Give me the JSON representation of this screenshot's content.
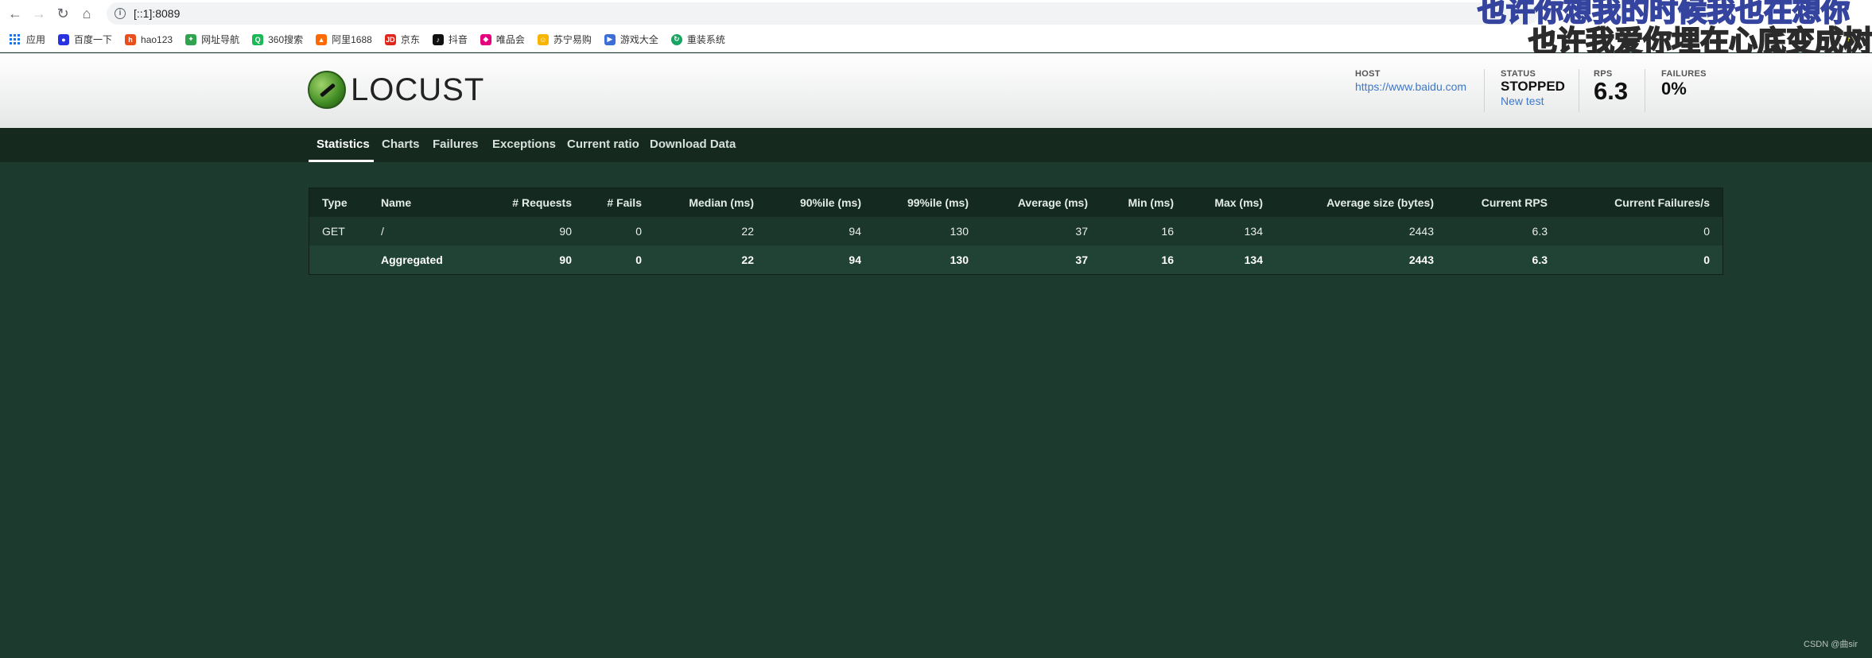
{
  "browser": {
    "url": "[::1]:8089",
    "icons": {
      "back": "back-arrow-icon",
      "forward": "forward-arrow-icon",
      "reload": "reload-icon",
      "home": "home-icon",
      "info": "info-icon"
    }
  },
  "bookmarks": [
    {
      "label": "应用",
      "icon": "apps-grid-icon",
      "color": "#1a73e8"
    },
    {
      "label": "百度一下",
      "icon": "baidu-paw-icon",
      "color": "#2932e1"
    },
    {
      "label": "hao123",
      "icon": "hao123-icon",
      "color": "#e94e1b"
    },
    {
      "label": "网址导航",
      "icon": "navigation-icon",
      "color": "#2ea44f"
    },
    {
      "label": "360搜索",
      "icon": "search-360-icon",
      "color": "#19b955"
    },
    {
      "label": "阿里1688",
      "icon": "ali1688-icon",
      "color": "#ff6a00"
    },
    {
      "label": "京东",
      "icon": "jd-icon",
      "color": "#e1251b"
    },
    {
      "label": "抖音",
      "icon": "douyin-icon",
      "color": "#111111"
    },
    {
      "label": "唯品会",
      "icon": "vip-icon",
      "color": "#e6007e"
    },
    {
      "label": "苏宁易购",
      "icon": "suning-icon",
      "color": "#f7b500"
    },
    {
      "label": "游戏大全",
      "icon": "games-icon",
      "color": "#3b6fd6"
    },
    {
      "label": "重装系统",
      "icon": "system-reinstall-icon",
      "color": "#19a463"
    }
  ],
  "overlay_caption": {
    "line1": "也许你想我的时候我也在想你",
    "line2": "也许我爱你埋在心底变成树"
  },
  "header": {
    "logo_text": "LOCUST",
    "host_label": "HOST",
    "host_value": "https://www.baidu.com",
    "status_label": "STATUS",
    "status_value": "STOPPED",
    "new_test_label": "New test",
    "rps_label": "RPS",
    "rps_value": "6.3",
    "failures_label": "FAILURES",
    "failures_value": "0%"
  },
  "tabs": [
    {
      "label": "Statistics",
      "active": true
    },
    {
      "label": "Charts",
      "active": false
    },
    {
      "label": "Failures",
      "active": false
    },
    {
      "label": "Exceptions",
      "active": false
    },
    {
      "label": "Current ratio",
      "active": false
    },
    {
      "label": "Download Data",
      "active": false
    }
  ],
  "chart_data": {
    "type": "table",
    "columns": [
      "Type",
      "Name",
      "# Requests",
      "# Fails",
      "Median (ms)",
      "90%ile (ms)",
      "99%ile (ms)",
      "Average (ms)",
      "Min (ms)",
      "Max (ms)",
      "Average size (bytes)",
      "Current RPS",
      "Current Failures/s"
    ],
    "rows": [
      [
        "GET",
        "/",
        "90",
        "0",
        "22",
        "94",
        "130",
        "37",
        "16",
        "134",
        "2443",
        "6.3",
        "0"
      ],
      [
        "",
        "Aggregated",
        "90",
        "0",
        "22",
        "94",
        "130",
        "37",
        "16",
        "134",
        "2443",
        "6.3",
        "0"
      ]
    ]
  },
  "watermark": "CSDN @曲sir"
}
